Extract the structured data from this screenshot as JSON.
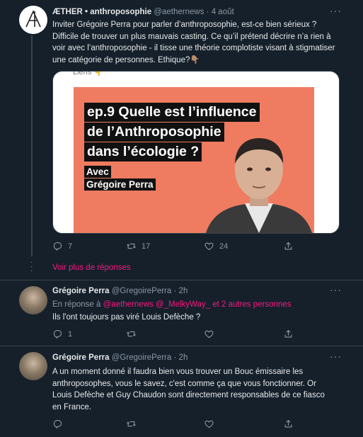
{
  "colors": {
    "background": "#15202b",
    "text": "#e7e9ea",
    "muted": "#8b98a5",
    "link": "#f91880",
    "accent": "#1d9bf0",
    "thumb_orange": "#ef7b60"
  },
  "tweet1": {
    "name": "ÆTHER • anthroposophie",
    "handle": "@aethernews",
    "date": "4 août",
    "text": "Inviter Grégoire Perra pour parler d’anthroposophie, est-ce bien sérieux ? Difficile de trouver un plus mauvais casting. Ce qu’il prétend décrire n’a rien à voir avec l’anthroposophie - il tisse une théorie complotiste visant à stigmatiser une catégorie de personnes. Ethique?👇🏽",
    "media": {
      "top_text": "Liens 👇",
      "title_lines": [
        "ep.9 Quelle est l’influence",
        "de l’Anthroposophie",
        "dans l’écologie ?"
      ],
      "sub_lines": [
        "Avec",
        "Grégoire Perra"
      ]
    },
    "replies": "7",
    "retweets": "17",
    "likes": "24",
    "icons": [
      "reply-icon",
      "retweet-icon",
      "like-icon",
      "share-icon"
    ]
  },
  "show_more": "Voir plus de réponses",
  "tweet2": {
    "name": "Grégoire Perra",
    "handle": "@GregoirePerra",
    "date": "2h",
    "reply_prefix": "En réponse à",
    "reply_to": "@aethernews @_MelkyWay_  et 2 autres personnes",
    "text": "Ils l'ont toujours pas viré Louis Defèche ?",
    "replies": "1",
    "retweets": "",
    "likes": ""
  },
  "tweet3": {
    "name": "Grégoire Perra",
    "handle": "@GregoirePerra",
    "date": "2h",
    "text": "A un moment donné il faudra bien vous trouver un Bouc émissaire les anthroposophes, vous le savez, c'est comme ça que vous fonctionner.  Or Louis Defèche et Guy Chaudon sont directement responsables de ce fiasco en France.",
    "replies": "",
    "retweets": "",
    "likes": ""
  }
}
